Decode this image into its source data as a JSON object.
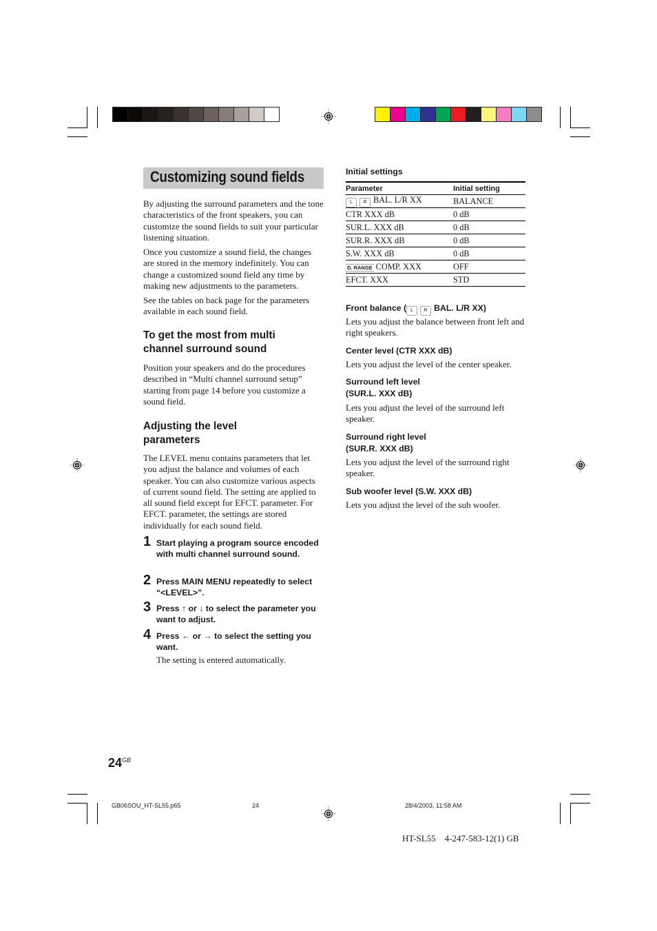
{
  "print_marks": {
    "grayscale_swatches": [
      "#000000",
      "#0c0a09",
      "#1b1716",
      "#262220",
      "#3b3230",
      "#514744",
      "#6c615d",
      "#877c78",
      "#a8a09d",
      "#d2cbc8",
      "#ffffff"
    ],
    "color_swatches": [
      "#fff200",
      "#ec008c",
      "#00aeef",
      "#2e3192",
      "#00a651",
      "#ed1c24",
      "#231f20",
      "#fff57a",
      "#f47fc0",
      "#7dd6f7",
      "#8c8c8c"
    ]
  },
  "left_column": {
    "title": "Customizing sound fields",
    "intro_paragraphs": [
      "By adjusting the surround parameters and the tone characteristics of the front speakers, you can customize the sound fields to suit your particular listening situation.",
      "Once you customize a sound field, the changes are stored in the memory indefinitely. You can change a customized sound field any time by making new adjustments to the parameters.",
      "See the tables on back page for the parameters available in each sound field."
    ],
    "section1": {
      "heading": "To get the most from multi channel surround sound",
      "text": "Position your speakers and do the procedures described in “Multi channel surround setup” starting from page 14 before you customize a sound field."
    },
    "section2": {
      "heading": "Adjusting the level parameters",
      "text": "The LEVEL menu contains parameters that let you adjust the balance and volumes of each speaker. You can also customize various aspects of current sound field. The setting are applied to all sound field except for EFCT. parameter. For EFCT. parameter, the settings are stored individually for each sound field."
    },
    "steps": [
      {
        "num": "1",
        "text": "Start playing a program source encoded with multi channel surround sound."
      },
      {
        "num": "2",
        "text": "Press MAIN MENU repeatedly to select “<LEVEL>”."
      },
      {
        "num": "3",
        "text": "Press ↑ or ↓ to select the parameter you want to adjust."
      },
      {
        "num": "4",
        "text": "Press ← or → to select the setting you want.",
        "note": "The setting is entered automatically."
      }
    ]
  },
  "right_column": {
    "table_title": "Initial settings",
    "table": {
      "headers": [
        "Parameter",
        "Initial setting"
      ],
      "rows": [
        {
          "icon": "speaker-lr",
          "param": "BAL. L/R XX",
          "value": "BALANCE"
        },
        {
          "param": "CTR XXX dB",
          "value": "0 dB"
        },
        {
          "param": "SUR.L. XXX dB",
          "value": "0 dB"
        },
        {
          "param": "SUR.R. XXX dB",
          "value": "0 dB"
        },
        {
          "param": "S.W. XXX dB",
          "value": "0 dB"
        },
        {
          "icon": "d-range",
          "param": "COMP. XXX",
          "value": "OFF"
        },
        {
          "param": "EFCT. XXX",
          "value": "STD"
        }
      ],
      "icon_labels": {
        "left": "L",
        "right": "R",
        "drange": "D. RANGE"
      }
    },
    "descriptions": [
      {
        "heading_pre": "Front balance (",
        "heading_post": "BAL. L/R XX)",
        "text": "Lets you adjust the balance between front left and right speakers."
      },
      {
        "heading": "Center level (CTR XXX dB)",
        "text": "Lets you adjust the level of the center speaker."
      },
      {
        "heading": "Surround left level (SUR.L. XXX dB)",
        "text": "Lets you adjust the level of the surround left speaker."
      },
      {
        "heading": "Surround right level (SUR.R. XXX dB)",
        "text": "Lets you adjust the level of the surround right speaker."
      },
      {
        "heading": "Sub woofer level (S.W. XXX dB)",
        "text": "Lets you adjust the level of the sub woofer."
      }
    ]
  },
  "footer": {
    "page_number": "24",
    "page_suffix": "GB",
    "file_name": "GB06SOU_HT-SL55.p65",
    "file_page": "24",
    "timestamp": "28/4/2003, 11:58 AM",
    "model_code": "HT-SL55    4-247-583-12(1) GB"
  }
}
